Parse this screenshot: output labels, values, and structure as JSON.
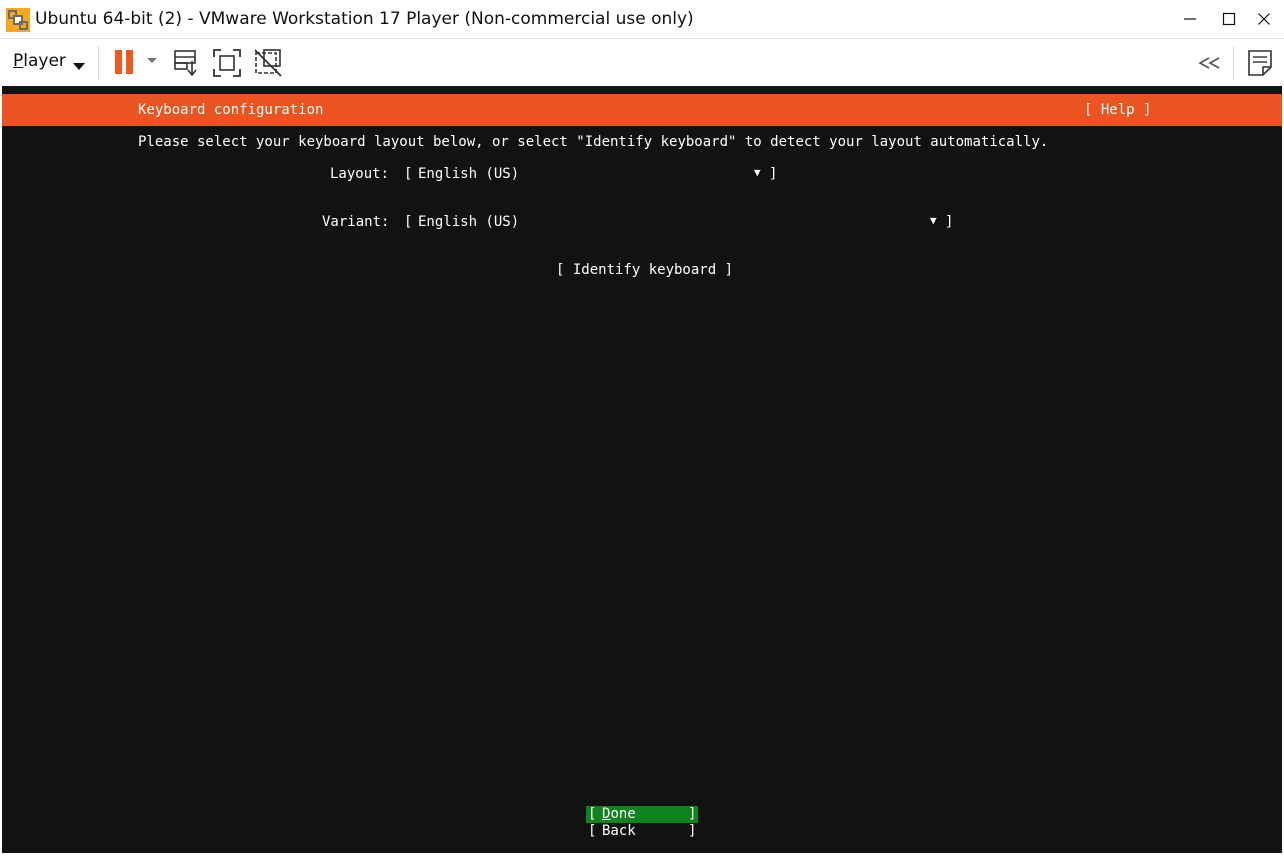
{
  "window": {
    "title": "Ubuntu 64-bit (2) - VMware Workstation 17 Player (Non-commercial use only)"
  },
  "toolbar": {
    "player_menu_label_first": "P",
    "player_menu_label_rest": "layer"
  },
  "vm": {
    "header": {
      "title": "Keyboard configuration",
      "help": "[ Help ]"
    },
    "instructions": "Please select your keyboard layout below, or select \"Identify keyboard\" to detect your layout automatically.",
    "layout": {
      "label": "Layout:",
      "open_bracket": "[",
      "value": "English (US)",
      "arrow": "▼",
      "close_bracket": "]"
    },
    "variant": {
      "label": "Variant:",
      "open_bracket": "[",
      "value": "English (US)",
      "arrow": "▼",
      "close_bracket": "]"
    },
    "identify_button": "[ Identify keyboard ]",
    "done": {
      "open": "[",
      "label_first": "D",
      "label_rest": "one",
      "close": "]"
    },
    "back": {
      "open": "[",
      "label": "Back",
      "close": "]"
    }
  },
  "colors": {
    "ubuntu_orange": "#e95420",
    "vm_background": "#121212",
    "done_highlight": "#0e8420",
    "pause_orange": "#f05a1e"
  },
  "icons": {
    "app": "vmware-icon",
    "minimize": "minimize-icon",
    "maximize": "maximize-icon",
    "close": "close-icon",
    "player_dropdown": "chevron-down-icon",
    "pause": "pause-icon",
    "pause_dropdown": "chevron-down-icon",
    "send_ctrl_alt_del": "send-ctrl-alt-del-icon",
    "fullscreen": "fullscreen-icon",
    "unity": "unity-icon",
    "collapse": "double-chevron-left-icon",
    "notes": "notes-icon"
  }
}
